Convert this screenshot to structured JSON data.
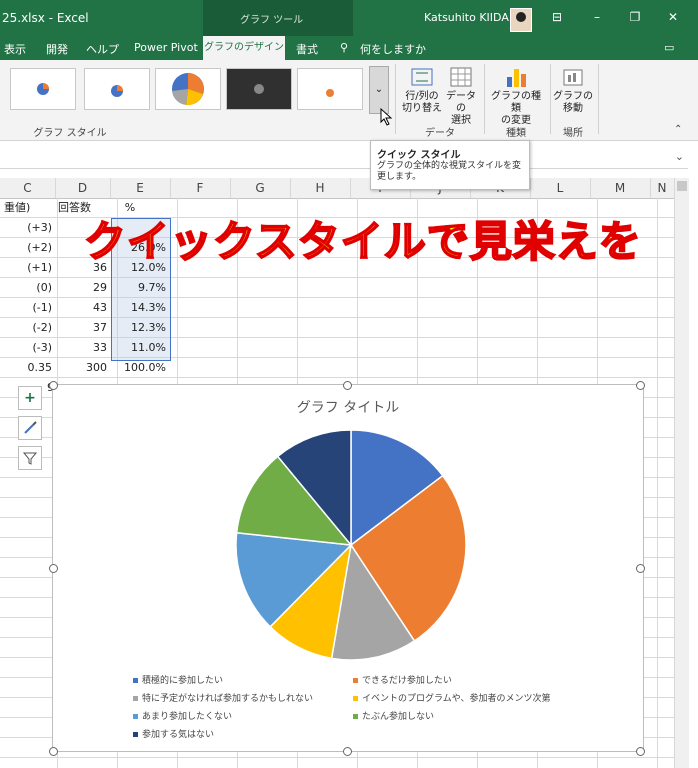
{
  "titlebar": {
    "filename": "25.xlsx  -  Excel",
    "context_label": "グラフ ツール",
    "user": "Katsuhito KIIDA"
  },
  "tabs": [
    {
      "label": "表示"
    },
    {
      "label": "開発"
    },
    {
      "label": "ヘルプ"
    },
    {
      "label": "Power Pivot"
    },
    {
      "label": "グラフのデザイン"
    },
    {
      "label": "書式"
    },
    {
      "label": "何をしますか"
    }
  ],
  "ribbon": {
    "chart_styles_label": "グラフ スタイル",
    "switch_row_col": [
      "行/列の",
      "切り替え"
    ],
    "select_data": [
      "データの",
      "選択"
    ],
    "data_group": "データ",
    "change_type": [
      "グラフの種類",
      "の変更"
    ],
    "type_group": "種類",
    "move_chart": [
      "グラフの",
      "移動"
    ],
    "location_group": "場所"
  },
  "tooltip": {
    "title": "クイック スタイル",
    "description": "グラフの全体的な視覚スタイルを変更します。"
  },
  "columns": [
    "C",
    "D",
    "E",
    "F",
    "G",
    "H",
    "I",
    "J",
    "K",
    "L",
    "M",
    "N"
  ],
  "sheet": {
    "header": [
      "重値)",
      "回答数",
      "%"
    ],
    "rows": [
      [
        "(+3)",
        "",
        ""
      ],
      [
        "(+2)",
        "",
        "26.0%"
      ],
      [
        "(+1)",
        "36",
        "12.0%"
      ],
      [
        "(0)",
        "29",
        "9.7%"
      ],
      [
        "(-1)",
        "43",
        "14.3%"
      ],
      [
        "(-2)",
        "37",
        "12.3%"
      ],
      [
        "(-3)",
        "33",
        "11.0%"
      ],
      [
        "0.35",
        "300",
        "100.0%"
      ]
    ],
    "partial": "9"
  },
  "banner": "クイックスタイルで見栄えを",
  "chart_data": {
    "type": "pie",
    "title": "グラフ タイトル",
    "categories": [
      "積極的に参加したい",
      "できるだけ参加したい",
      "特に予定がなければ参加するかもしれない",
      "イベントのプログラムや、参加者のメンツ次第",
      "あまり参加したくない",
      "たぶん参加しない",
      "参加する気はない"
    ],
    "values": [
      14.7,
      26.0,
      12.0,
      9.7,
      14.3,
      12.3,
      11.0
    ],
    "colors": [
      "#4472c4",
      "#ed7d31",
      "#a5a5a5",
      "#ffc000",
      "#5b9bd5",
      "#70ad47",
      "#264478"
    ],
    "legend_position": "bottom"
  },
  "icons": {
    "chart_elements": "plus-icon",
    "chart_styles": "brush-icon",
    "chart_filters": "filter-icon"
  }
}
